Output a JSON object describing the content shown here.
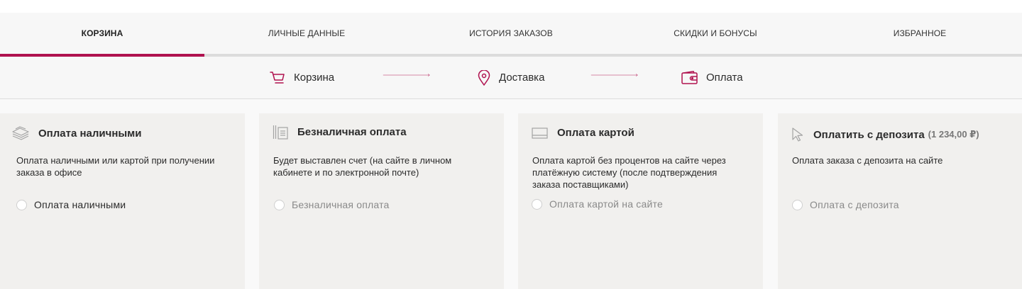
{
  "tabs": [
    {
      "label": "КОРЗИНА",
      "active": true
    },
    {
      "label": "ЛИЧНЫЕ ДАННЫЕ",
      "active": false
    },
    {
      "label": "ИСТОРИЯ ЗАКАЗОВ",
      "active": false
    },
    {
      "label": "СКИДКИ И БОНУСЫ",
      "active": false
    },
    {
      "label": "ИЗБРАННОЕ",
      "active": false
    }
  ],
  "steps": [
    {
      "label": "Корзина",
      "icon": "cart-icon"
    },
    {
      "label": "Доставка",
      "icon": "location-pin-icon"
    },
    {
      "label": "Оплата",
      "icon": "wallet-icon"
    }
  ],
  "payment_options": [
    {
      "title": "Оплата наличными",
      "extra": "",
      "description": "Оплата наличными или картой при получении заказа в офисе",
      "radio_label": "Оплата наличными",
      "icon": "cash-stack-icon",
      "enabled": true
    },
    {
      "title": "Безналичная оплата",
      "extra": "",
      "description": "Будет выставлен счет (на сайте в личном кабинете и по электронной почте)",
      "radio_label": "Безналичная оплата",
      "icon": "invoice-icon",
      "enabled": false
    },
    {
      "title": "Оплата картой",
      "extra": "",
      "description": "Оплата картой без процентов на сайте через платёжную систему (после подтверждения заказа поставщиками)",
      "radio_label": "Оплата картой на сайте",
      "icon": "card-icon",
      "enabled": false
    },
    {
      "title": "Оплатить с депозита",
      "extra": "(1 234,00 ₽)",
      "description": "Оплата заказа с депозита на сайте",
      "radio_label": "Оплата с депозита",
      "icon": "cursor-pointer-icon",
      "enabled": false
    }
  ],
  "colors": {
    "accent": "#b0124f",
    "rail": "#dcdcdc",
    "card_bg": "#f1f0ee"
  }
}
